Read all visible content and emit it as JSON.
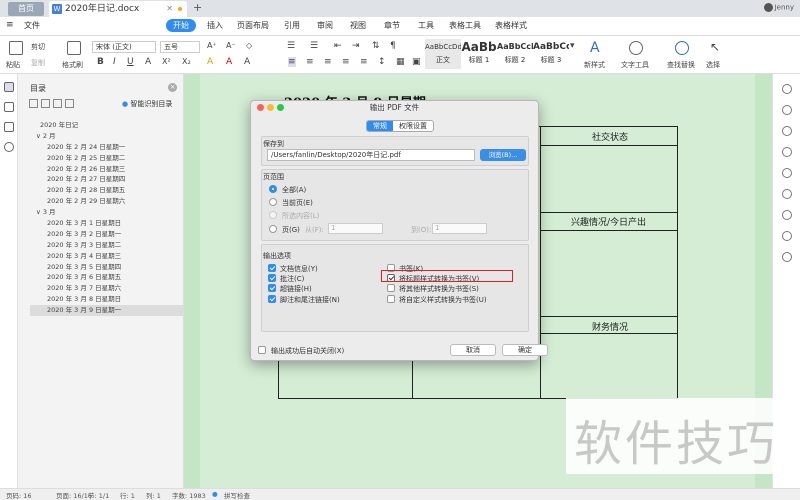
{
  "titlebar": {
    "home_tab": "首页",
    "doc_tab": "2020年日记.docx",
    "doc_icon": "W",
    "close_glyph": "✕",
    "new_tab_glyph": "+",
    "user_name": "Jenny"
  },
  "menubar": {
    "file": "文件",
    "items": [
      "开始",
      "插入",
      "页面布局",
      "引用",
      "审阅",
      "视图",
      "章节",
      "工具",
      "表格工具",
      "表格样式"
    ]
  },
  "ribbon": {
    "paste": "粘贴",
    "cut": "剪切",
    "copy": "复制",
    "format_painter": "格式刷",
    "font_name": "宋体 (正文)",
    "font_size": "五号",
    "styles": [
      {
        "sample": "AaBbCcDd",
        "name": "正文"
      },
      {
        "sample": "AaBb",
        "name": "标题 1"
      },
      {
        "sample": "AaBbCcI",
        "name": "标题 2"
      },
      {
        "sample": "AaBbCc",
        "name": "标题 3"
      }
    ],
    "new_style": "新样式",
    "text_tools": "文字工具",
    "find_replace": "查找替换",
    "select": "选择"
  },
  "toc": {
    "title": "目录",
    "smart_label": "智能识别目录",
    "items": [
      {
        "label": "2020 年日记",
        "level": 0
      },
      {
        "label": "2 月",
        "level": 1
      },
      {
        "label": "2020 年 2 月 24 日星期一",
        "level": 2
      },
      {
        "label": "2020 年 2 月 25 日星期二",
        "level": 2
      },
      {
        "label": "2020 年 2 月 26 日星期三",
        "level": 2
      },
      {
        "label": "2020 年 2 月 27 日星期四",
        "level": 2
      },
      {
        "label": "2020 年 2 月 28 日星期五",
        "level": 2
      },
      {
        "label": "2020 年 2 月 29 日星期六",
        "level": 2
      },
      {
        "label": "3 月",
        "level": 1
      },
      {
        "label": "2020 年 3 月 1 日星期日",
        "level": 2
      },
      {
        "label": "2020 年 3 月 2 日星期一",
        "level": 2
      },
      {
        "label": "2020 年 3 月 3 日星期二",
        "level": 2
      },
      {
        "label": "2020 年 3 月 4 日星期三",
        "level": 2
      },
      {
        "label": "2020 年 3 月 5 日星期四",
        "level": 2
      },
      {
        "label": "2020 年 3 月 6 日星期五",
        "level": 2
      },
      {
        "label": "2020 年 3 月 7 日星期六",
        "level": 2
      },
      {
        "label": "2020 年 3 月 8 日星期日",
        "level": 2
      },
      {
        "label": "2020 年 3 月 9 日星期一",
        "level": 2,
        "selected": true
      }
    ]
  },
  "document": {
    "heading": "2020 年 3 月 9 日星期一",
    "cells": [
      "社交状态",
      "兴趣情况/今日产出",
      "财务情况"
    ]
  },
  "dialog": {
    "title": "输出 PDF 文件",
    "tabs": [
      "常规",
      "权限设置"
    ],
    "save_to_label": "保存到",
    "path": "/Users/fanlin/Desktop/2020年日记.pdf",
    "browse": "浏览(B)...",
    "range_label": "页范围",
    "range_all": "全部(A)",
    "range_current": "当前页(E)",
    "range_selection": "所选内容(L)",
    "range_pages": "页(G)",
    "from_label": "从(F):",
    "from_value": "1",
    "to_label": "到(O):",
    "to_value": "1",
    "output_label": "输出选项",
    "options_left": [
      {
        "label": "文档信息(Y)",
        "checked": true
      },
      {
        "label": "批注(C)",
        "checked": true
      },
      {
        "label": "超链接(H)",
        "checked": true
      },
      {
        "label": "脚注和尾注链接(N)",
        "checked": true
      }
    ],
    "options_right": [
      {
        "label": "书签(K)",
        "checked": false
      },
      {
        "label": "将标题样式转换为书签(V)",
        "checked": true
      },
      {
        "label": "将其他样式转换为书签(S)",
        "checked": false
      },
      {
        "label": "将自定义样式转换为书签(U)",
        "checked": false
      }
    ],
    "auto_close": "输出成功后自动关闭(X)",
    "cancel": "取消",
    "ok": "确定",
    "accent_color": "#2f8cf0",
    "highlight_color": "#e02020"
  },
  "status": {
    "page_num": "页码: 16",
    "pages": "页面: 16/16",
    "section": "节: 1/1",
    "row": "行: 1",
    "col": "列: 1",
    "words": "字数: 1983",
    "spell": "拼写检查"
  },
  "watermark": "软件技巧"
}
